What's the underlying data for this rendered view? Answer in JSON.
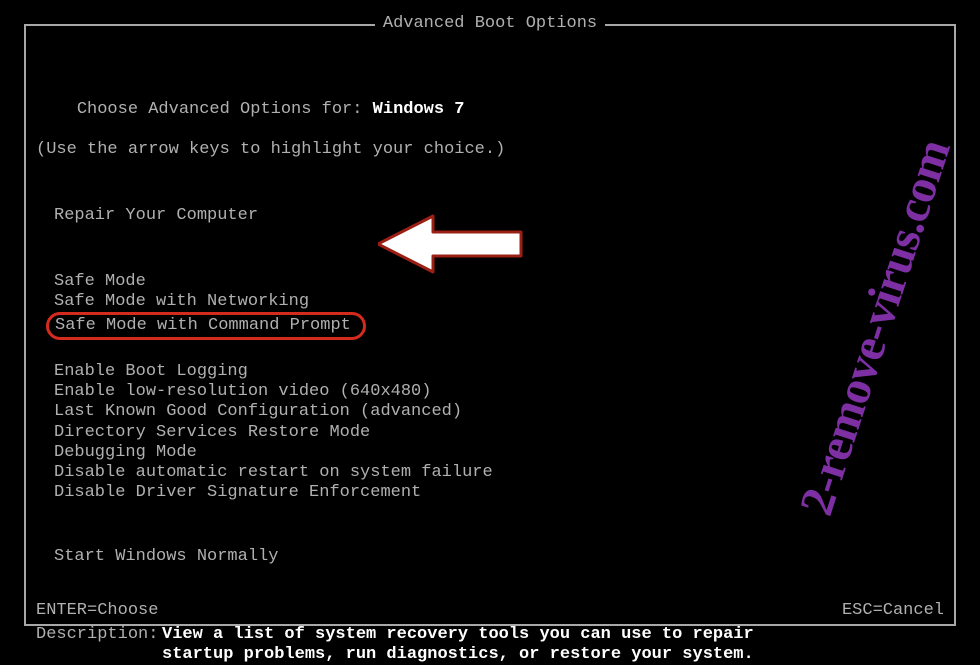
{
  "title": "Advanced Boot Options",
  "choose_label": "Choose Advanced Options for: ",
  "os_name": "Windows 7",
  "hint": "(Use the arrow keys to highlight your choice.)",
  "repair": "Repair Your Computer",
  "options1": [
    "Safe Mode",
    "Safe Mode with Networking",
    "Safe Mode with Command Prompt"
  ],
  "options2": [
    "Enable Boot Logging",
    "Enable low-resolution video (640x480)",
    "Last Known Good Configuration (advanced)",
    "Directory Services Restore Mode",
    "Debugging Mode",
    "Disable automatic restart on system failure",
    "Disable Driver Signature Enforcement"
  ],
  "start_normally": "Start Windows Normally",
  "desc_label": "Description:",
  "desc_line1": "View a list of system recovery tools you can use to repair",
  "desc_line2": "startup problems, run diagnostics, or restore your system.",
  "footer_left": "ENTER=Choose",
  "footer_right": "ESC=Cancel",
  "watermark": "2-remove-virus.com",
  "colors": {
    "highlight_border": "#d52b1e",
    "watermark": "#7d2fa3"
  }
}
